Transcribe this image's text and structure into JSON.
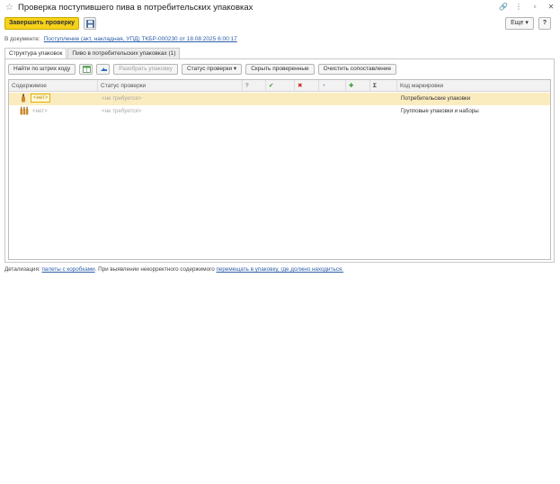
{
  "window": {
    "title": "Проверка поступившего пива в потребительских упаковках",
    "link_icon": "🔗",
    "menu_icon": "⋮",
    "minimize_icon": "▫",
    "close_icon": "✕"
  },
  "toolbar": {
    "finish_label": "Завершить проверку",
    "more_label": "Еще ▾",
    "help_label": "?"
  },
  "document": {
    "prefix": "В документе:",
    "link": "Поступление (акт, накладная, УПД) ТКБР-000230 от 18.08.2025 6:00:17"
  },
  "tabs": [
    {
      "label": "Структура упаковок",
      "active": true
    },
    {
      "label": "Пиво в потребительских упаковках (1)",
      "active": false
    }
  ],
  "actions": {
    "find_barcode": "Найти по штрих коду",
    "unpack": "Разобрать упаковку",
    "check_status": "Статус проверки ▾",
    "hide_checked": "Скрыть проверенные",
    "clear_match": "Очистить сопоставление"
  },
  "table": {
    "columns": {
      "content": "Содержимое",
      "status": "Статус проверки",
      "q": "?",
      "check": "✔",
      "cross": "✖",
      "clock": "◔",
      "plus": "✚",
      "sigma": "Σ",
      "code": "Код маркировки"
    },
    "rows": [
      {
        "content": "<нет>",
        "status": "<не требуется>",
        "code": "Потребительские упаковки",
        "selected": true
      },
      {
        "content": "<нет>",
        "status": "<не требуется>",
        "code": "Групповые упаковки и наборы",
        "selected": false
      }
    ]
  },
  "footer": {
    "prefix": "Детализация:",
    "link1": "палеты с коробками",
    "middle": ". При выявлении некорректного содержимого",
    "link2": "перемещать в упаковку, где должно находиться."
  },
  "colors": {
    "primary_button": "#f7d21a",
    "selected_row": "#fbecc0",
    "link": "#2b5ea8",
    "check_green": "#2e9a2e",
    "cross_red": "#c62828"
  }
}
